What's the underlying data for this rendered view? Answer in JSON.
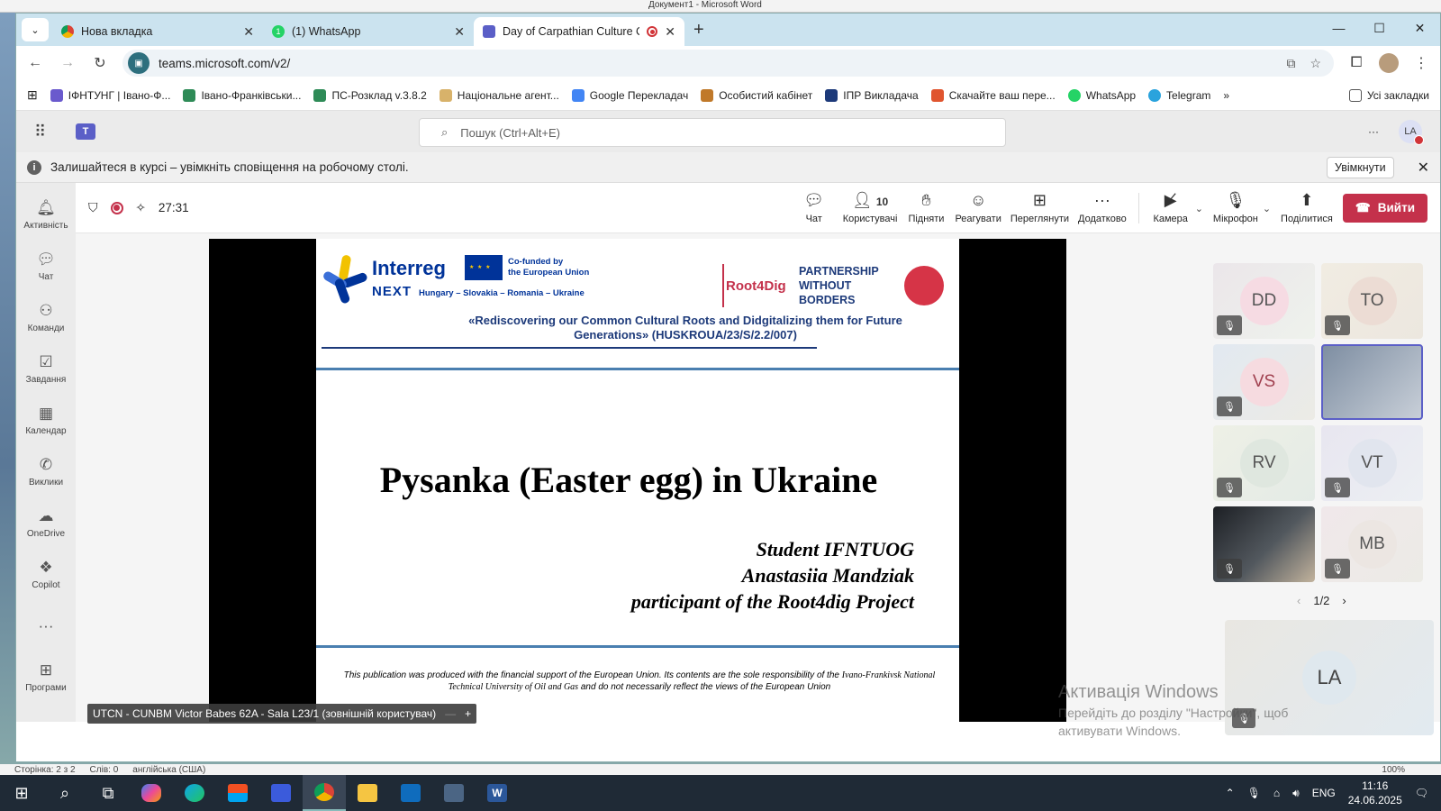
{
  "word": {
    "title_fragment": "Документ1 - Microsoft Word",
    "status_page": "Сторінка: 2 з 2",
    "status_words": "Слів: 0",
    "status_lang": "англійська (США)",
    "zoom": "100%"
  },
  "browser": {
    "tabs": [
      {
        "label": "Нова вкладка",
        "favicon": "chrome-icon"
      },
      {
        "label": "(1) WhatsApp",
        "favicon": "whatsapp-icon"
      },
      {
        "label": "Day of Carpathian Culture C",
        "favicon": "teams-icon",
        "active": true
      }
    ],
    "url": "teams.microsoft.com/v2/",
    "bookmarks": [
      "ІФНТУНГ | Івано-Ф...",
      "Івано-Франківськи...",
      "ПС-Розклад v.3.8.2",
      "Національне агент...",
      "Google Перекладач",
      "Особистий кабінет",
      "ІПР Викладача",
      "Скачайте ваш пере...",
      "WhatsApp",
      "Telegram"
    ],
    "all_bookmarks": "Усі закладки"
  },
  "teams": {
    "search_placeholder": "Пошук (Ctrl+Alt+E)",
    "avatar_initials": "LA",
    "notification": "Залишайтеся в курсі – увімкніть сповіщення на робочому столі.",
    "notification_button": "Увімкнути",
    "rail": [
      {
        "label": "Активність",
        "icon": "bell-icon"
      },
      {
        "label": "Чат",
        "icon": "chat-icon"
      },
      {
        "label": "Команди",
        "icon": "teams-icon"
      },
      {
        "label": "Завдання",
        "icon": "tasks-icon"
      },
      {
        "label": "Календар",
        "icon": "calendar-icon"
      },
      {
        "label": "Виклики",
        "icon": "phone-icon"
      },
      {
        "label": "OneDrive",
        "icon": "cloud-icon"
      },
      {
        "label": "Copilot",
        "icon": "copilot-icon"
      },
      {
        "label": "Програми",
        "icon": "apps-icon"
      }
    ],
    "meeting": {
      "timer": "27:31",
      "participants_count": "10",
      "tools": {
        "chat": "Чат",
        "people": "Користувачі",
        "raise": "Підняти",
        "react": "Реагувати",
        "view": "Переглянути",
        "more": "Додатково",
        "camera": "Камера",
        "mic": "Мікрофон",
        "share": "Поділитися"
      },
      "leave": "Вийти",
      "presenter_name": "UTCN - CUNBM Victor Babes 62A - Sala L23/1 (зовнішній користувач)",
      "gallery": [
        "DD",
        "TO",
        "VS",
        "",
        "RV",
        "VT",
        "",
        "MB"
      ],
      "page": "1/2",
      "self_initials": "LA"
    }
  },
  "slide": {
    "interreg": "Interreg",
    "next": "NEXT",
    "countries": "Hungary – Slovakia – Romania – Ukraine",
    "cofunded": "Co-funded by\nthe European Union",
    "root4dig": "Root4Dig",
    "partnership": "PARTNERSHIP\nWITHOUT\nBORDERS",
    "project": "«Rediscovering our Common Cultural Roots and Didgitalizing them for Future Generations» (HUSKROUA/23/S/2.2/007)",
    "title": "Pysanka (Easter egg) in Ukraine",
    "author_lines": [
      "Student IFNTUOG",
      "Anastasiia Mandziak",
      "participant of the Root4dig Project"
    ],
    "disclaimer_a": "This publication was produced with the financial support of the European Union. Its contents are the sole responsibility of the",
    "disclaimer_b": "Ivano-Frankivsk National Technical University of Oil and Gas",
    "disclaimer_c": "and do not necessarily reflect the views of the European Union"
  },
  "windows": {
    "activation_title": "Активація Windows",
    "activation_text": "Перейдіть до розділу \"Настройки\", щоб активувати Windows.",
    "lang": "ENG",
    "time": "11:16",
    "date": "24.06.2025"
  }
}
